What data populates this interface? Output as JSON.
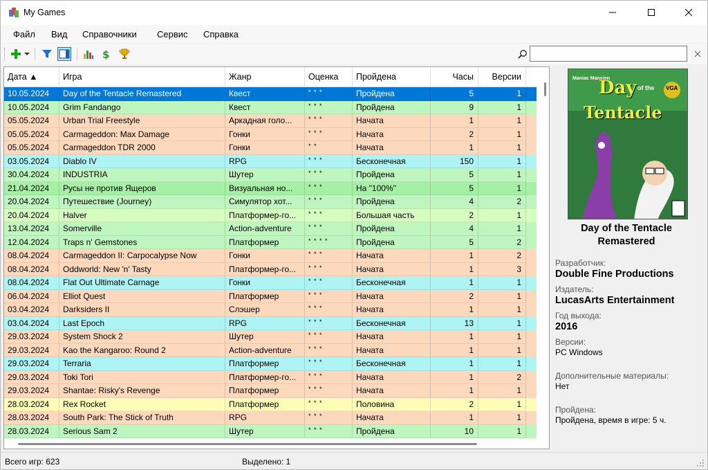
{
  "window": {
    "title": "My Games"
  },
  "menu": [
    "Файл",
    "Вид",
    "Справочники",
    "Сервис",
    "Справка"
  ],
  "search": {
    "value": "",
    "placeholder": ""
  },
  "colors": {
    "beige": "#fcd9bd",
    "green": "#bff5bf",
    "cyan": "#aef4f4",
    "yellow": "#fdfdb8",
    "brightgreen": "#a6f0a6",
    "lightgreen": "#d6fcc0",
    "selected": "#0078d7"
  },
  "grid": {
    "columns": [
      "Дата ▲",
      "Игра",
      "Жанр",
      "Оценка",
      "Пройдена",
      "Часы",
      "Версии"
    ],
    "rows": [
      {
        "date": "10.05.2024",
        "game": "Day of the Tentacle Remastered",
        "genre": "Квест",
        "rating": "* * *",
        "status": "Пройдена",
        "hours": "5",
        "versions": "1",
        "color": "selected"
      },
      {
        "date": "10.05.2024",
        "game": "Grim Fandango",
        "genre": "Квест",
        "rating": "* * *",
        "status": "Пройдена",
        "hours": "9",
        "versions": "1",
        "color": "green"
      },
      {
        "date": "05.05.2024",
        "game": "Urban Trial Freestyle",
        "genre": "Аркадная голо...",
        "rating": "* * *",
        "status": "Начата",
        "hours": "1",
        "versions": "1",
        "color": "beige"
      },
      {
        "date": "05.05.2024",
        "game": "Carmageddon: Max Damage",
        "genre": "Гонки",
        "rating": "* * *",
        "status": "Начата",
        "hours": "2",
        "versions": "1",
        "color": "beige"
      },
      {
        "date": "05.05.2024",
        "game": "Carmageddon TDR 2000",
        "genre": "Гонки",
        "rating": "* *",
        "status": "Начата",
        "hours": "1",
        "versions": "1",
        "color": "beige"
      },
      {
        "date": "03.05.2024",
        "game": "Diablo IV",
        "genre": "RPG",
        "rating": "* * *",
        "status": "Бесконечная",
        "hours": "150",
        "versions": "1",
        "color": "cyan"
      },
      {
        "date": "30.04.2024",
        "game": "INDUSTRIA",
        "genre": "Шутер",
        "rating": "* * *",
        "status": "Пройдена",
        "hours": "5",
        "versions": "1",
        "color": "green"
      },
      {
        "date": "21.04.2024",
        "game": "Русы не против Ящеров",
        "genre": "Визуальная но...",
        "rating": "* * *",
        "status": "На \"100%\"",
        "hours": "5",
        "versions": "1",
        "color": "brightgreen"
      },
      {
        "date": "20.04.2024",
        "game": "Путешествие (Journey)",
        "genre": "Симулятор хот...",
        "rating": "* * *",
        "status": "Пройдена",
        "hours": "4",
        "versions": "2",
        "color": "green"
      },
      {
        "date": "20.04.2024",
        "game": "Halver",
        "genre": "Платформер-го...",
        "rating": "* * *",
        "status": "Большая часть",
        "hours": "2",
        "versions": "1",
        "color": "lightgreen"
      },
      {
        "date": "13.04.2024",
        "game": "Somerville",
        "genre": "Action-adventure",
        "rating": "* * *",
        "status": "Пройдена",
        "hours": "4",
        "versions": "1",
        "color": "green"
      },
      {
        "date": "12.04.2024",
        "game": "Traps n' Gemstones",
        "genre": "Платформер",
        "rating": "* * * *",
        "status": "Пройдена",
        "hours": "5",
        "versions": "2",
        "color": "green"
      },
      {
        "date": "08.04.2024",
        "game": "Carmageddon II: Carpocalypse Now",
        "genre": "Гонки",
        "rating": "* * *",
        "status": "Начата",
        "hours": "1",
        "versions": "2",
        "color": "beige"
      },
      {
        "date": "08.04.2024",
        "game": "Oddworld: New 'n' Tasty",
        "genre": "Платформер-го...",
        "rating": "* * *",
        "status": "Начата",
        "hours": "1",
        "versions": "3",
        "color": "beige"
      },
      {
        "date": "08.04.2024",
        "game": "Flat Out Ultimate Carnage",
        "genre": "Гонки",
        "rating": "* * *",
        "status": "Бесконечная",
        "hours": "1",
        "versions": "1",
        "color": "cyan"
      },
      {
        "date": "06.04.2024",
        "game": "Elliot Quest",
        "genre": "Платформер",
        "rating": "* * *",
        "status": "Начата",
        "hours": "2",
        "versions": "1",
        "color": "beige"
      },
      {
        "date": "03.04.2024",
        "game": "Darksiders II",
        "genre": "Слэшер",
        "rating": "* * *",
        "status": "Начата",
        "hours": "1",
        "versions": "1",
        "color": "beige"
      },
      {
        "date": "03.04.2024",
        "game": "Last Epoch",
        "genre": "RPG",
        "rating": "* * *",
        "status": "Бесконечная",
        "hours": "13",
        "versions": "1",
        "color": "cyan"
      },
      {
        "date": "29.03.2024",
        "game": "System Shock 2",
        "genre": "Шутер",
        "rating": "* * *",
        "status": "Начата",
        "hours": "1",
        "versions": "1",
        "color": "beige"
      },
      {
        "date": "29.03.2024",
        "game": "Kao the Kangaroo: Round 2",
        "genre": "Action-adventure",
        "rating": "* * *",
        "status": "Начата",
        "hours": "1",
        "versions": "1",
        "color": "beige"
      },
      {
        "date": "29.03.2024",
        "game": "Terraria",
        "genre": "Платформер",
        "rating": "* * *",
        "status": "Бесконечная",
        "hours": "1",
        "versions": "1",
        "color": "cyan"
      },
      {
        "date": "29.03.2024",
        "game": "Toki Tori",
        "genre": "Платформер-го...",
        "rating": "* * *",
        "status": "Начата",
        "hours": "1",
        "versions": "2",
        "color": "beige"
      },
      {
        "date": "29.03.2024",
        "game": "Shantae: Risky's Revenge",
        "genre": "Платформер",
        "rating": "* * *",
        "status": "Начата",
        "hours": "1",
        "versions": "1",
        "color": "beige"
      },
      {
        "date": "28.03.2024",
        "game": "Rex Rocket",
        "genre": "Платформер",
        "rating": "* * *",
        "status": "Половина",
        "hours": "2",
        "versions": "1",
        "color": "yellow"
      },
      {
        "date": "28.03.2024",
        "game": "South Park: The Stick of Truth",
        "genre": "RPG",
        "rating": "* * *",
        "status": "Начата",
        "hours": "1",
        "versions": "1",
        "color": "beige"
      },
      {
        "date": "28.03.2024",
        "game": "Serious Sam 2",
        "genre": "Шутер",
        "rating": "* * *",
        "status": "Пройдена",
        "hours": "10",
        "versions": "1",
        "color": "green"
      }
    ]
  },
  "details": {
    "title": "Day of the Tentacle Remastered",
    "cover_text": {
      "line1": "Day",
      "line2": "of the",
      "line3": "Tentacle",
      "top": "Maniac Mansion",
      "badge": "VGA"
    },
    "developer_label": "Разработчик:",
    "developer": "Double Fine Productions",
    "publisher_label": "Издатель:",
    "publisher": "LucasArts Entertainment",
    "year_label": "Год выхода:",
    "year": "2016",
    "versions_label": "Версии:",
    "versions": "PC Windows",
    "extra_label": "Дополнительные материалы:",
    "extra": "Нет",
    "completed_label": "Пройдена:",
    "completed": "Пройдена, время в игре: 5 ч."
  },
  "status": {
    "total": "Всего игр: 623",
    "selected": "Выделено: 1"
  }
}
